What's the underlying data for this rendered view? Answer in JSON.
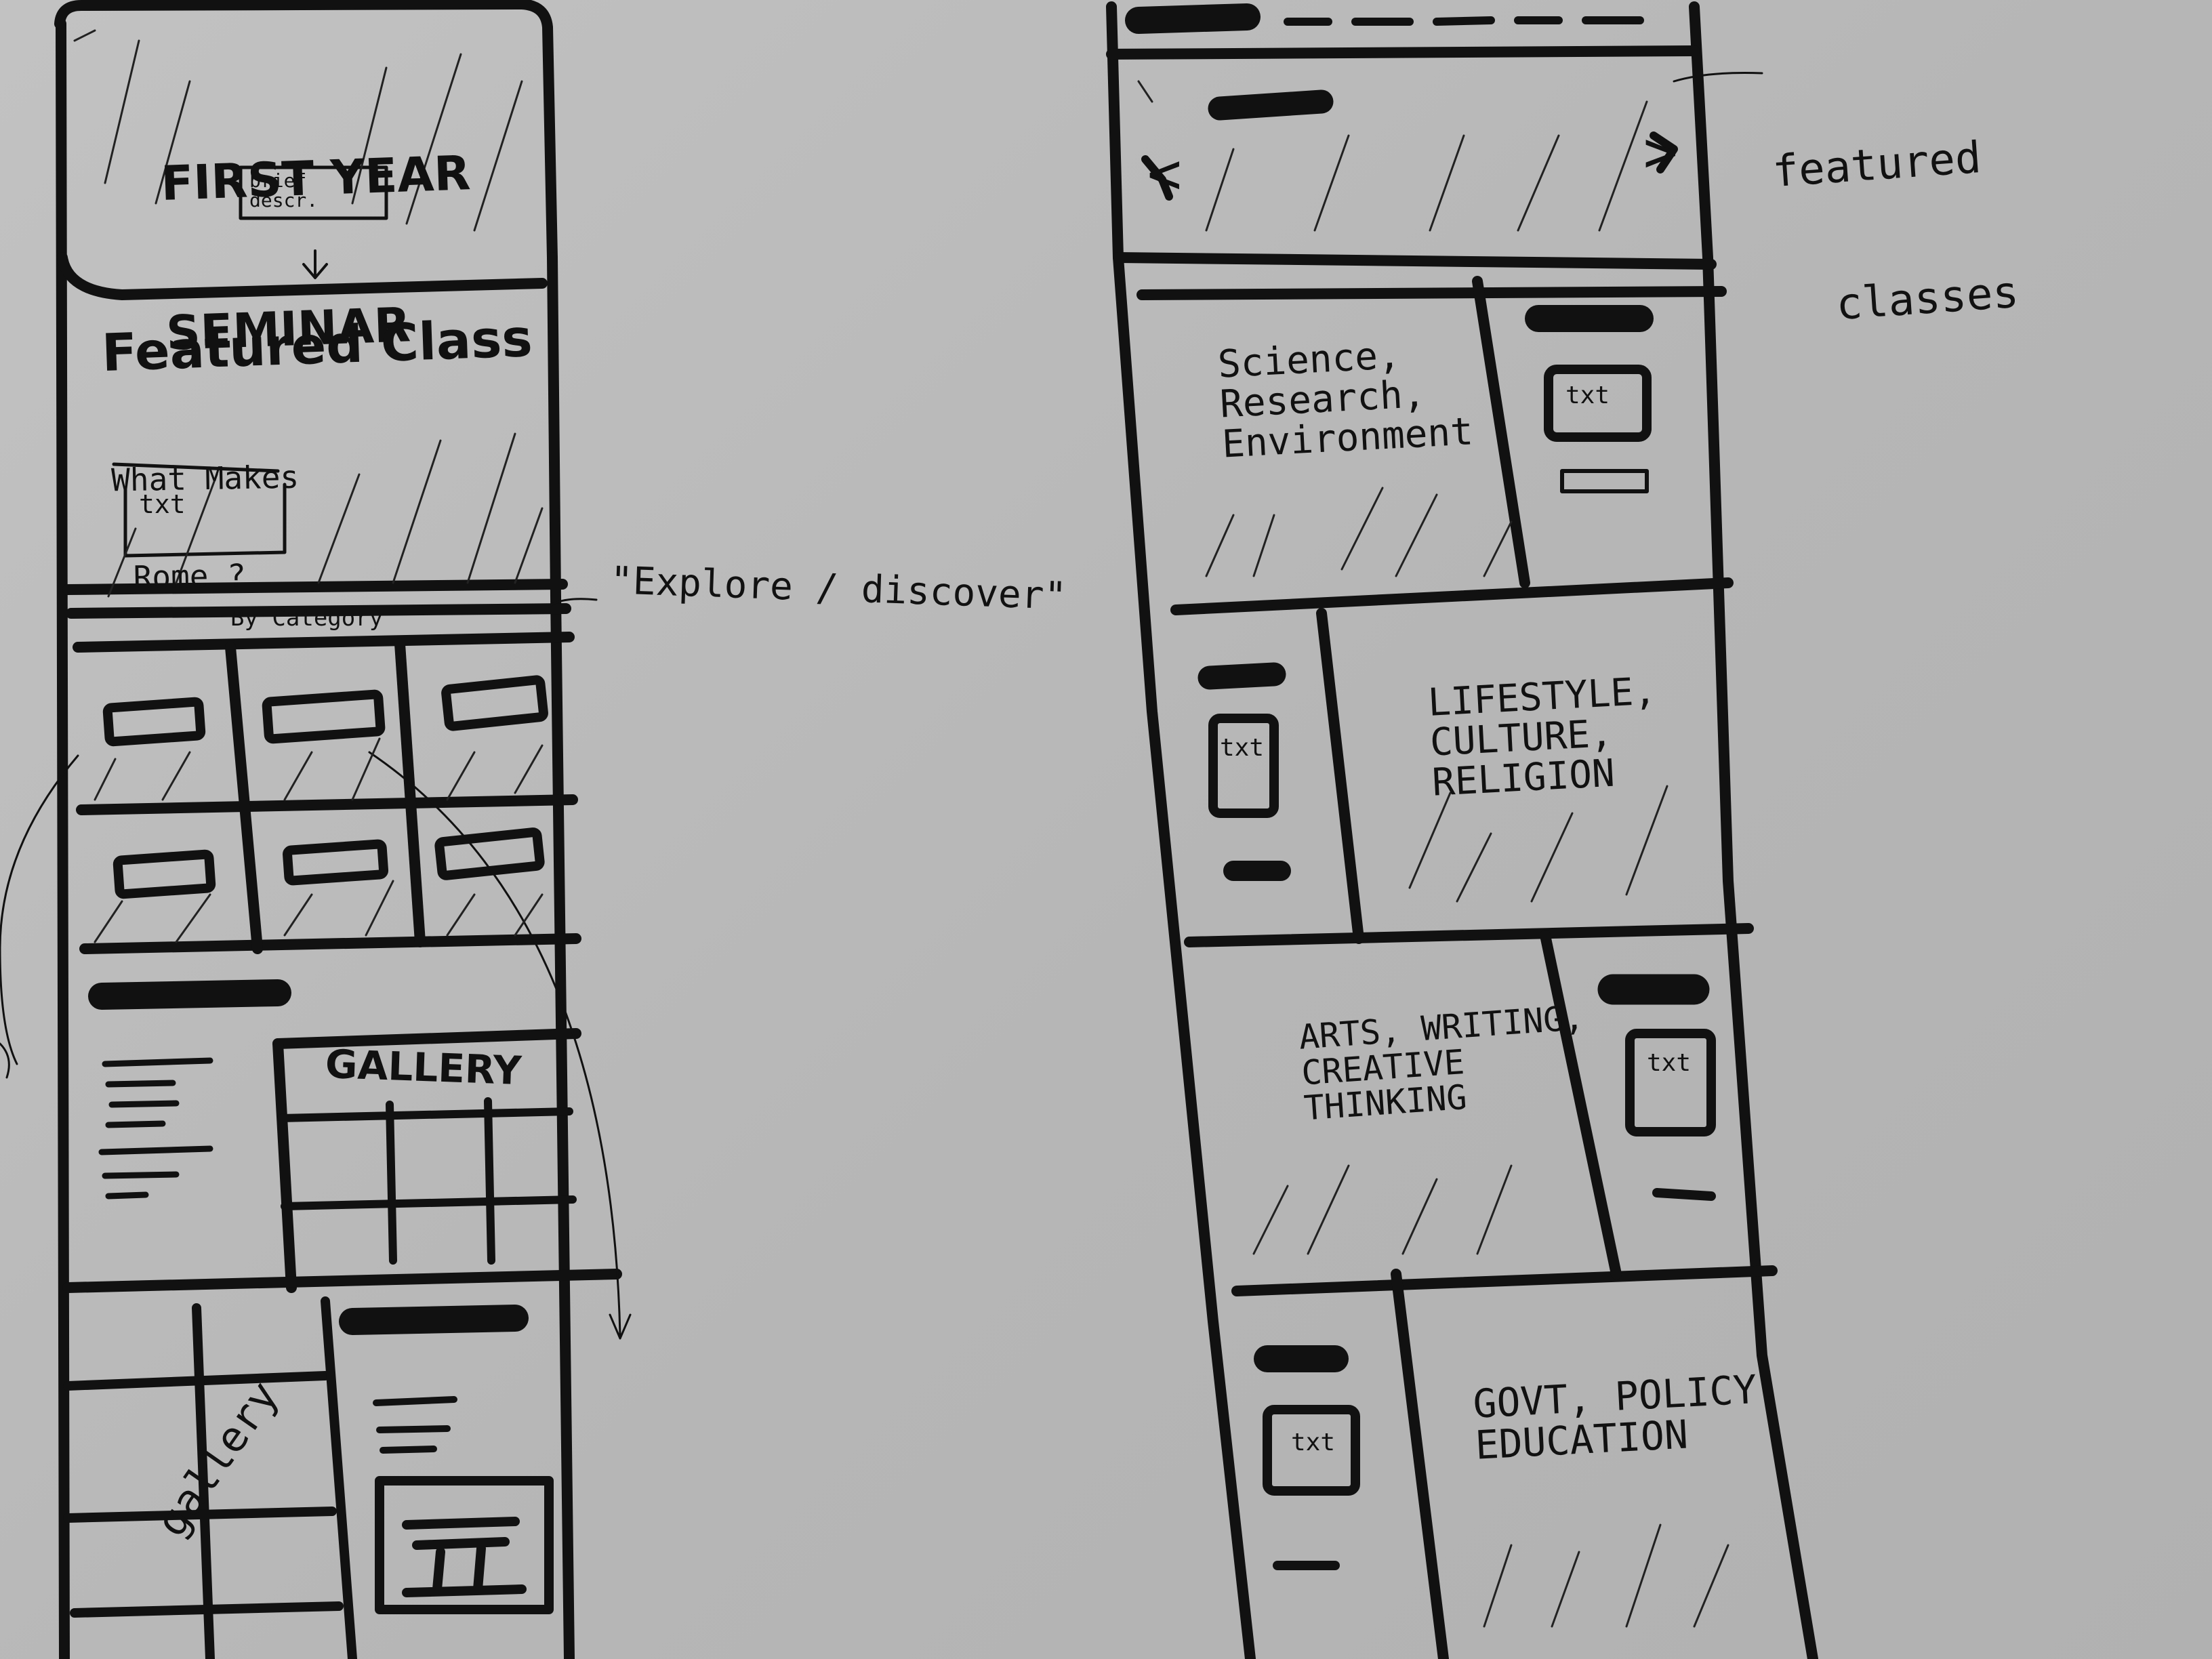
{
  "left_wireframe": {
    "hero": {
      "title_line1": "FIRST YEAR",
      "title_line2": "SEMINAR",
      "brief_desc": "brief\ndescr."
    },
    "featured": {
      "heading": "Featured Class",
      "question_line1": "What Makes",
      "question_line2": "Rome ?",
      "txt": "txt"
    },
    "explore": {
      "by_category": "By Category"
    },
    "gallery_label_1": "GALLERY",
    "gallery_label_2": "gallery"
  },
  "annotations": {
    "explore_discover": "\"Explore / discover\"",
    "featured_classes_line1": "featured",
    "featured_classes_line2": "classes"
  },
  "right_wireframe": {
    "nav_prev": "<",
    "nav_next": ">",
    "sections": [
      {
        "text": "Science,\nResearch,\nEnvironment",
        "side_txt": "txt"
      },
      {
        "text": "LIFESTYLE,\nCULTURE,\nRELIGION",
        "side_txt": "txt"
      },
      {
        "text": "ARTS, WRITING,\nCREATIVE\nTHINKING",
        "side_txt": "txt"
      },
      {
        "text": "GOVT, POLICY,\nEDUCATION",
        "side_txt": "txt"
      }
    ]
  }
}
